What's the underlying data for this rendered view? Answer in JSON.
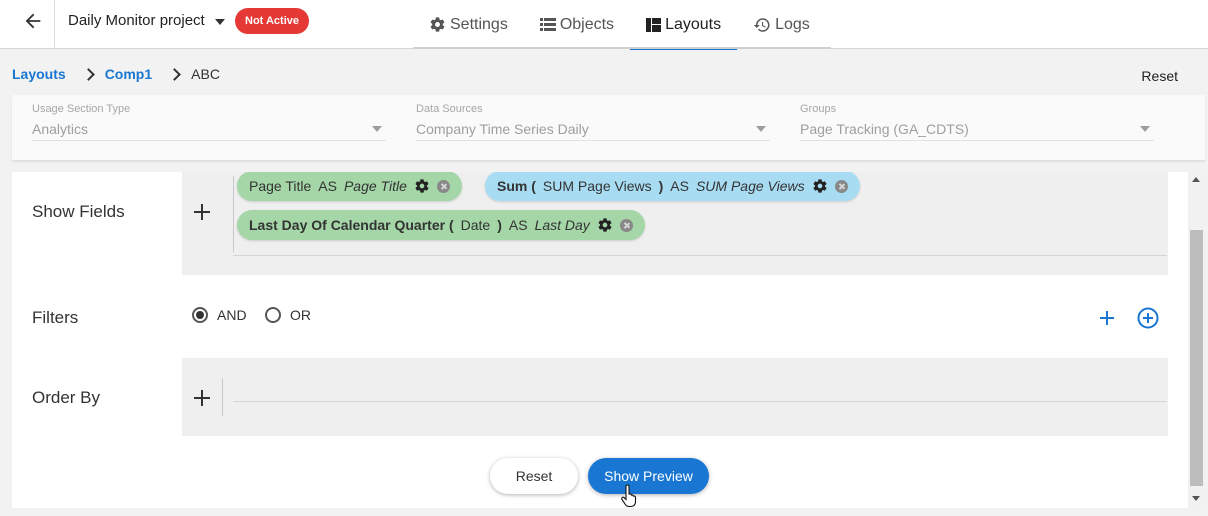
{
  "header": {
    "project_name": "Daily Monitor project",
    "status_badge": "Not Active",
    "tabs": [
      {
        "label": "Settings",
        "icon": "gear-icon"
      },
      {
        "label": "Objects",
        "icon": "list-icon"
      },
      {
        "label": "Layouts",
        "icon": "layout-icon",
        "active": true
      },
      {
        "label": "Logs",
        "icon": "history-icon"
      }
    ]
  },
  "breadcrumb": {
    "items": [
      "Layouts",
      "Comp1",
      "ABC"
    ],
    "reset_label": "Reset"
  },
  "selectors": {
    "usage_section_type": {
      "label": "Usage Section Type",
      "value": "Analytics"
    },
    "data_sources": {
      "label": "Data Sources",
      "value": "Company Time Series Daily"
    },
    "groups": {
      "label": "Groups",
      "value": "Page Tracking (GA_CDTS)"
    }
  },
  "show_fields": {
    "title": "Show Fields",
    "chips": [
      {
        "field": "Page Title",
        "as": "AS",
        "alias": "Page Title",
        "color": "#a5d6a7"
      },
      {
        "func": "Sum",
        "open": "(",
        "field": "SUM Page Views",
        "close": ")",
        "as": "AS",
        "alias": "SUM Page Views",
        "color": "#a8dcf3"
      },
      {
        "func": "Last Day Of Calendar Quarter",
        "open": "(",
        "field": "Date",
        "close": ")",
        "as": "AS",
        "alias": "Last Day",
        "color": "#a5d6a7"
      }
    ]
  },
  "filters": {
    "title": "Filters",
    "options": [
      "AND",
      "OR"
    ],
    "selected": "AND"
  },
  "order_by": {
    "title": "Order By"
  },
  "actions": {
    "reset_label": "Reset",
    "preview_label": "Show Preview"
  },
  "colors": {
    "accent": "#1976d2",
    "badge_red": "#e53935"
  }
}
